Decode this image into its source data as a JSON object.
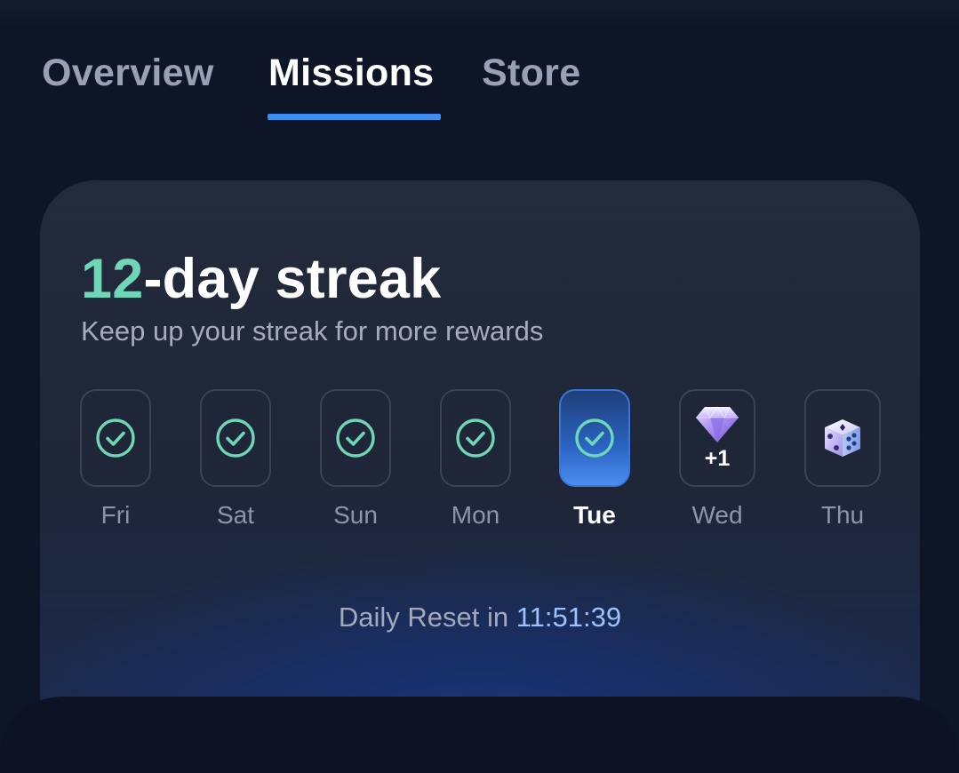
{
  "tabs": [
    {
      "label": "Overview",
      "active": false
    },
    {
      "label": "Missions",
      "active": true
    },
    {
      "label": "Store",
      "active": false
    }
  ],
  "streak": {
    "count": "12",
    "title_suffix": "-day streak",
    "subtitle": "Keep up your streak for more rewards"
  },
  "days": [
    {
      "label": "Fri",
      "status": "completed",
      "icon": "check-circle-icon"
    },
    {
      "label": "Sat",
      "status": "completed",
      "icon": "check-circle-icon"
    },
    {
      "label": "Sun",
      "status": "completed",
      "icon": "check-circle-icon"
    },
    {
      "label": "Mon",
      "status": "completed",
      "icon": "check-circle-icon"
    },
    {
      "label": "Tue",
      "status": "current",
      "icon": "check-circle-icon"
    },
    {
      "label": "Wed",
      "status": "reward",
      "icon": "diamond-icon",
      "reward": "+1"
    },
    {
      "label": "Thu",
      "status": "reward",
      "icon": "dice-icon"
    }
  ],
  "reset": {
    "label": "Daily Reset in ",
    "time": "11:51:39"
  },
  "colors": {
    "accent": "#3d8ef0",
    "streak_green": "#6fd6b8",
    "timer_blue": "#9cc1ff",
    "background": "#0e1526"
  }
}
